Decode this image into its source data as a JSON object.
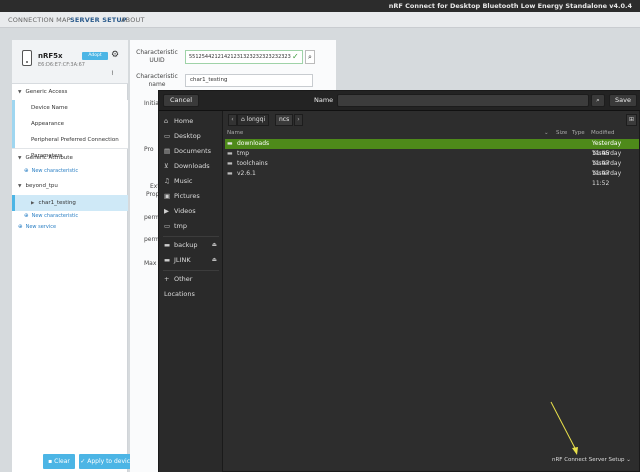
{
  "app": {
    "title": "nRF Connect for Desktop Bluetooth Low Energy Standalone v4.0.4"
  },
  "nav": {
    "tabs": [
      "CONNECTION MAP",
      "SERVER SETUP",
      "ABOUT"
    ]
  },
  "device": {
    "name": "nRF5x",
    "address": "E6:D6:E7:CF:3A:67",
    "adopt_label": "Adopt"
  },
  "tree": {
    "generic_access": "Generic Access",
    "device_name": "Device Name",
    "appearance": "Appearance",
    "ppcp": "Peripheral Preferred Connection Parameters",
    "generic_attribute": "Generic Attribute",
    "new_characteristic_1": "New characteristic",
    "beyond_tpu": "beyond_tpu",
    "char1_testing": "char1_testing",
    "new_characteristic_2": "New characteristic",
    "new_service": "New service"
  },
  "buttons": {
    "clear": "Clear",
    "apply": "Apply to device"
  },
  "form": {
    "uuid_label": "Characteristic UUID",
    "uuid_value": "55125442121421231323232323232323",
    "name_label": "Characteristic name",
    "name_value": "char1_testing",
    "initial_label": "Initial",
    "pro_label": "Pro",
    "ext_label": "Ext",
    "prop_label": "Prop",
    "perm1_label": "perm",
    "perm2_label": "perm",
    "max_label": "Max"
  },
  "dialog": {
    "cancel": "Cancel",
    "name_label": "Name",
    "save": "Save",
    "places": [
      "Home",
      "Desktop",
      "Documents",
      "Downloads",
      "Music",
      "Pictures",
      "Videos",
      "tmp"
    ],
    "devices": [
      "backup",
      "JLINK"
    ],
    "other": "Other Locations",
    "path": [
      "longqi",
      "ncs"
    ],
    "columns": {
      "name": "Name",
      "size": "Size",
      "type": "Type",
      "modified": "Modified"
    },
    "files": [
      {
        "name": "downloads",
        "modified": "Yesterday   11:45"
      },
      {
        "name": "tmp",
        "modified": "Yesterday   11:47"
      },
      {
        "name": "toolchains",
        "modified": "Yesterday   11:47"
      },
      {
        "name": "v2.6.1",
        "modified": "Yesterday   11:52"
      }
    ],
    "filter": "nRF Connect Server Setup"
  },
  "colors": {
    "accent": "#4cb5e5",
    "selected_row": "#4e8a1a",
    "arrow": "#e8e04a"
  }
}
